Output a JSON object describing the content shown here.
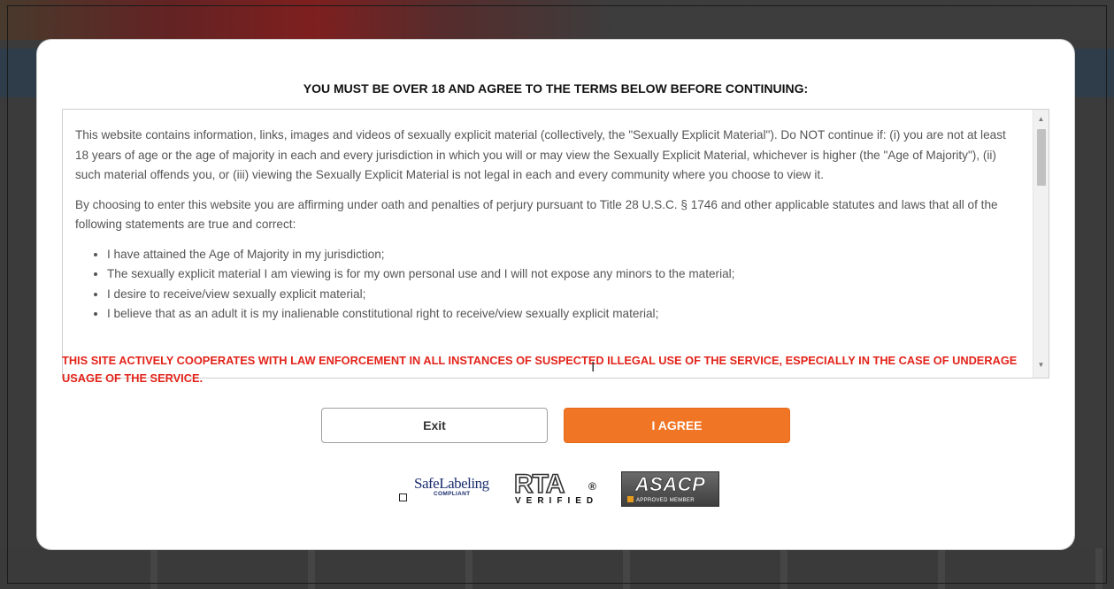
{
  "modal": {
    "title": "YOU MUST BE OVER 18 AND AGREE TO THE TERMS BELOW BEFORE CONTINUING:",
    "terms": {
      "paragraph1": "This website contains information, links, images and videos of sexually explicit material (collectively, the \"Sexually Explicit Material\"). Do NOT continue if: (i) you are not at least 18 years of age or the age of majority in each and every jurisdiction in which you will or may view the Sexually Explicit Material, whichever is higher (the \"Age of Majority\"), (ii) such material offends you, or (iii) viewing the Sexually Explicit Material is not legal in each and every community where you choose to view it.",
      "paragraph2": "By choosing to enter this website you are affirming under oath and penalties of perjury pursuant to Title 28 U.S.C. § 1746 and other applicable statutes and laws that all of the following statements are true and correct:",
      "statements": [
        "I have attained the Age of Majority in my jurisdiction;",
        "The sexually explicit material I am viewing is for my own personal use and I will not expose any minors to the material;",
        "I desire to receive/view sexually explicit material;",
        "I believe that as an adult it is my inalienable constitutional right to receive/view sexually explicit material;"
      ]
    },
    "warning": "THIS SITE ACTIVELY COOPERATES WITH LAW ENFORCEMENT IN ALL INSTANCES OF SUSPECTED ILLEGAL USE OF THE SERVICE, ESPECIALLY IN THE CASE OF UNDERAGE USAGE OF THE SERVICE.",
    "buttons": {
      "exit_label": "Exit",
      "agree_label": "I AGREE"
    },
    "badges": {
      "safelabeling": {
        "name": "SafeLabeling",
        "sub": "COMPLIANT"
      },
      "rta": {
        "name": "RTA",
        "reg": "®",
        "sub": "VERIFIED"
      },
      "asacp": {
        "name": "ASACP",
        "sub": "APPROVED MEMBER"
      }
    }
  },
  "colors": {
    "accent": "#f07525",
    "warning": "#e2231a",
    "text": "#555555"
  },
  "icons": {
    "cursor": "text-cursor-icon",
    "scroll_up": "scroll-up-arrow-icon",
    "scroll_down": "scroll-down-arrow-icon",
    "checkbox": "checkbox-icon"
  }
}
